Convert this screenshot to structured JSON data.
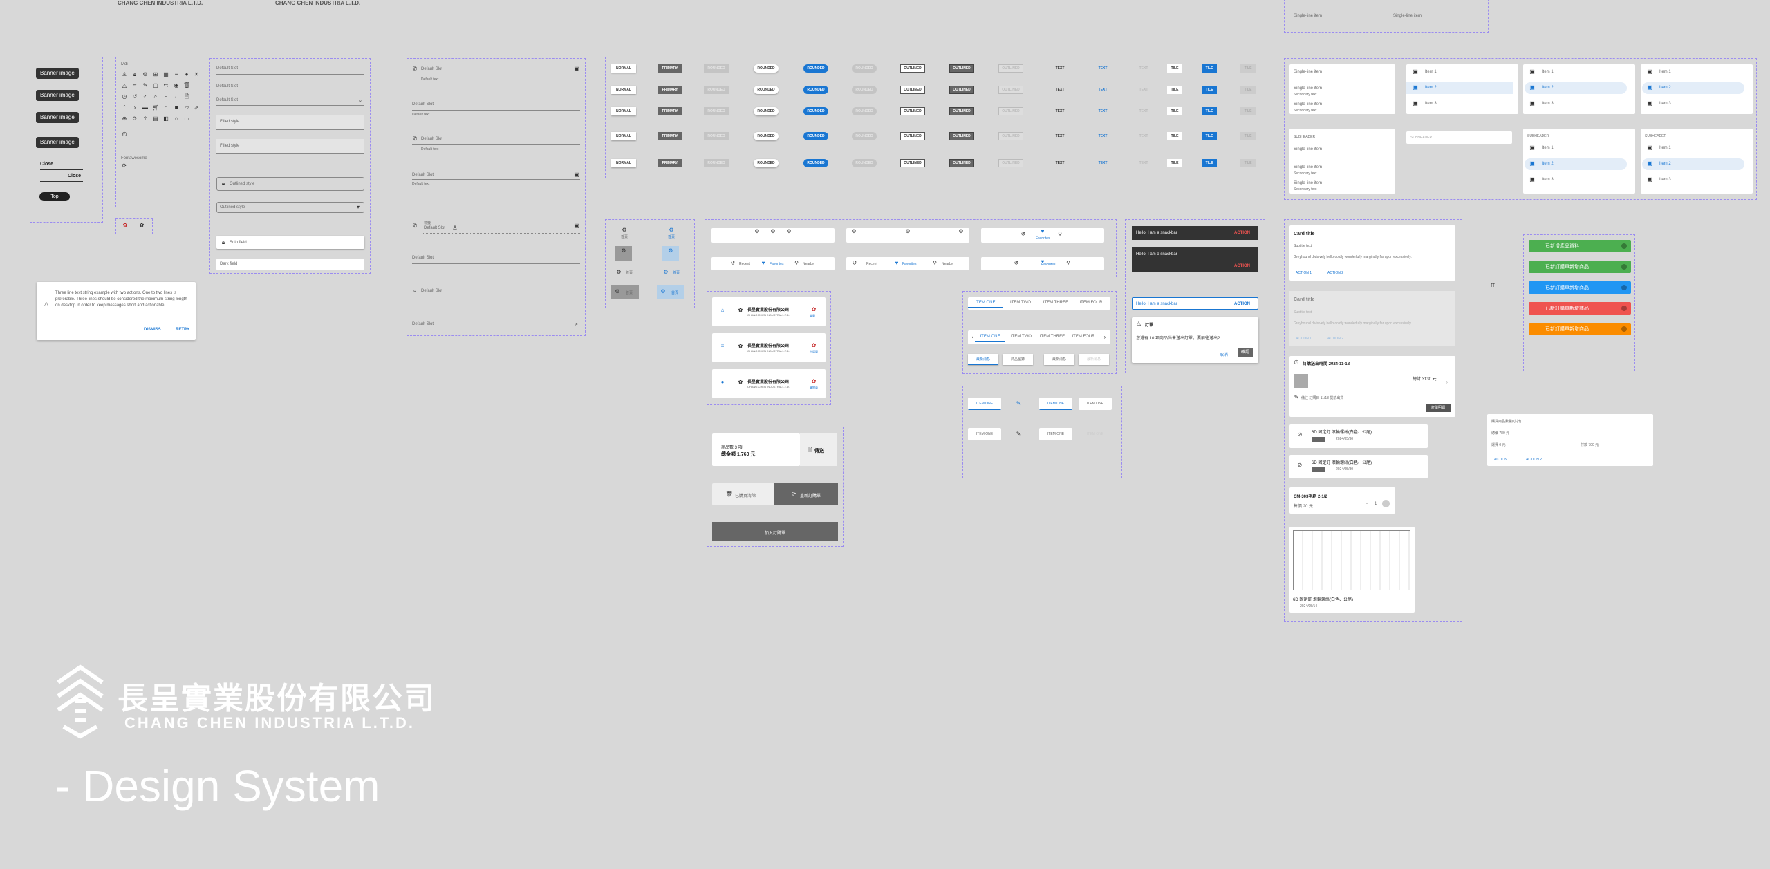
{
  "brand": {
    "company_zh": "長呈實業股份有限公司",
    "company_en": "CHANG CHEN INDUSTRIA L.T.D.",
    "subtitle": "- Design System",
    "top_logo_en_1": "CHANG CHEN INDUSTRIA L.T.D.",
    "top_logo_en_2": "CHANG CHEN INDUSTRIA L.T.D."
  },
  "top_list": {
    "item1": "Single-line item",
    "item2": "Single-line item"
  },
  "banners": {
    "items": [
      "Banner image",
      "Banner image",
      "Banner image",
      "Banner image"
    ],
    "close1": "Close",
    "close2": "Close",
    "top": "Top"
  },
  "dialog": {
    "text": "Three line text string example with two actions. One to two lines is preferable. Three lines should be considered the maximum string length on desktop in order to keep messages short and actionable.",
    "dismiss": "DISMISS",
    "retry": "RETRY"
  },
  "icons": {
    "label1": "Mdi",
    "label2": "Fontawesome"
  },
  "fields_a": {
    "default_slot": "Default Slot",
    "filled": "Filled style",
    "outlined": "Outlined style",
    "solo": "Solo field",
    "dark": "Dark field"
  },
  "fields_b": {
    "default_slot": "Default Slot",
    "default_text": "Default text",
    "label": "標籤"
  },
  "buttons": {
    "normal": "NORMAL",
    "primary": "PRIMARY",
    "rounded": "ROUNDED",
    "outlined": "OUTLINED",
    "text": "TEXT",
    "tile": "TILE"
  },
  "side_nav": {
    "label": "首頁"
  },
  "bottom_nav": {
    "a": "最近",
    "recent": "Recent",
    "favorites": "Favorites",
    "nearby": "Nearby"
  },
  "header_tabs": {
    "label_zh": "長呈實業股份有限公司",
    "label_en": "CHANG CHEN INDUSTRIA L.T.D.",
    "right1": "會員",
    "right2": "主選單",
    "right3": "購物車"
  },
  "cart": {
    "count_line": "商品數 3 項",
    "total": "總金額 1,760 元",
    "send": "傳送",
    "clear": "已購買清除",
    "return": "重新訂購單",
    "add": "加入訂購單"
  },
  "snackbars": {
    "s1": "Hello, I am a snackbar",
    "s2": "Hello, I am a snackbar",
    "s3": "Hello, I am a snackbar",
    "action": "ACTION"
  },
  "confirm": {
    "title": "訂單",
    "text": "您還有 10 項商品尚未送出訂單，要前往送出?",
    "cancel": "取消",
    "ok": "確認"
  },
  "tabs": {
    "items": [
      "ITEM ONE",
      "ITEM TWO",
      "ITEM THREE",
      "ITEM FOUR"
    ],
    "chips": [
      "最新消息",
      "商品型錄",
      "最新消息",
      "最新消息"
    ]
  },
  "lists": {
    "single": "Single-line item",
    "secondary": "Secondary text",
    "subheader": "SUBHEADER",
    "item1": "Item 1",
    "item2": "Item 2",
    "item3": "Item 3"
  },
  "cards": {
    "title": "Card title",
    "subtitle": "Subtitle text",
    "body": "Greyhound divisively hello coldly wonderfully marginally far upon excessively.",
    "action1": "ACTION 1",
    "action2": "ACTION 2"
  },
  "order": {
    "title": "訂購送出時間 2024-11-18",
    "total": "總計 3130 元",
    "button": "訂單明細",
    "note": "備註 訂購日 11/18 提前出貨"
  },
  "products": {
    "p1": "6D 固定釘 滾輪螺絲(白色、公尾)",
    "p2": "6D 固定釘 滾輪螺絲(白色、公尾)",
    "date1": "2024/05/30",
    "date2": "2024/05/30",
    "model": "CM-303毛刷 2-1/2",
    "price": "售價 20 元",
    "qty": "1",
    "p3": "6D 固定釘 滾輪螺絲(白色、公尾)",
    "date3": "2024/05/14"
  },
  "notices": {
    "n1": "已新增產品資料",
    "n2": "已新訂購單新增商品",
    "n3": "已新訂購單新增商品",
    "n4": "已新訂購單新增商品",
    "n5": "已新訂購單新增商品",
    "colors": [
      "#4caf50",
      "#4caf50",
      "#2196f3",
      "#ef5350",
      "#fb8c00"
    ]
  },
  "info_card": {
    "title": "購買商品數量(小計)",
    "l1": "總價 780 元",
    "l2": "運費 0 元",
    "l3": "付款 700 元",
    "a1": "ACTION 1",
    "a2": "ACTION 2"
  }
}
